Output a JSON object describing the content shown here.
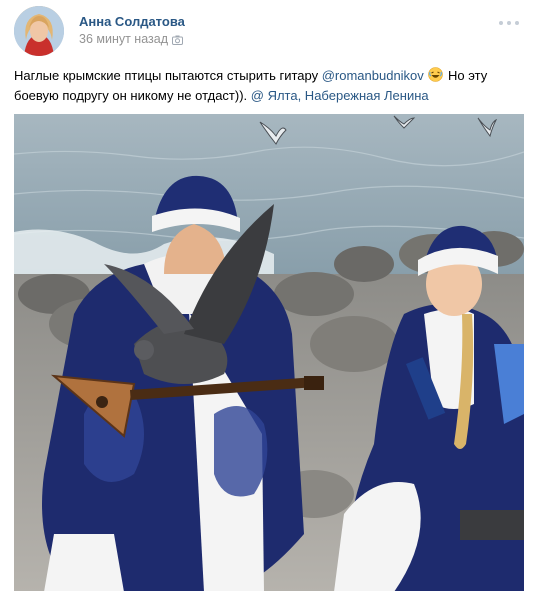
{
  "post": {
    "author": "Анна Солдатова",
    "time": "36 минут назад",
    "text": {
      "part1": "Наглые крымские птицы пытаются стырить гитару ",
      "mention": "@romanbudnikov",
      "part2": " Но эту",
      "part3": "боевую подругу он никому не отдаст)). ",
      "location": "@ Ялта, Набережная Ленина"
    },
    "icons": {
      "meta": "camera-icon",
      "emoji": "laughing-emoji-icon",
      "menu": "more-dots-icon"
    },
    "colors": {
      "link": "#2a5885",
      "meta": "#939393",
      "sea": "#6f8997",
      "costume": "#1e2b6e"
    }
  }
}
